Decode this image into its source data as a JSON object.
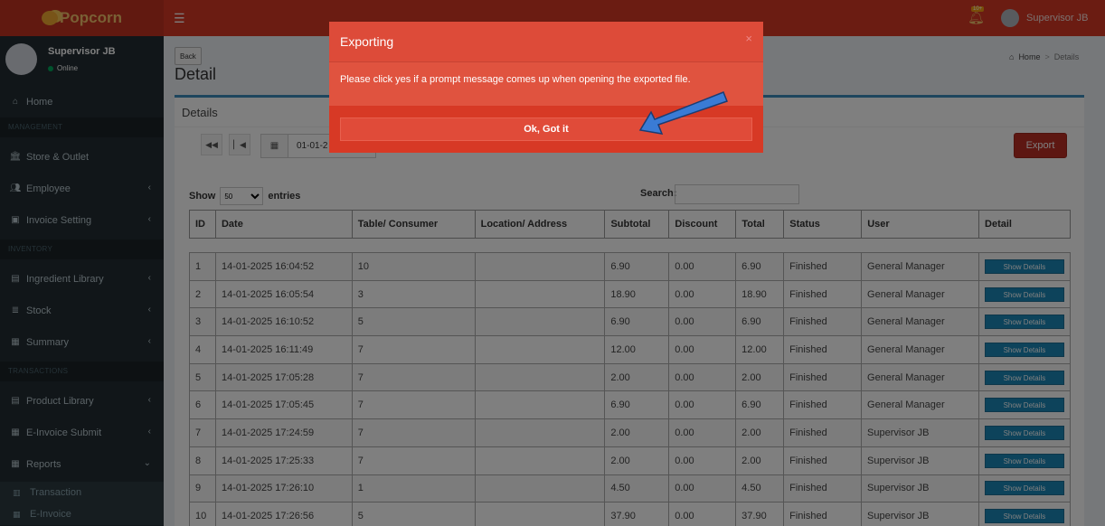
{
  "app": {
    "logo": "Popcorn",
    "notif_badge": "10+",
    "user": "Supervisor JB"
  },
  "sidebar": {
    "user_name": "Supervisor JB",
    "status": "Online",
    "sections": {
      "management": "MANAGEMENT",
      "inventory": "INVENTORY",
      "transactions": "TRANSACTIONS"
    },
    "items": {
      "home": "Home",
      "store": "Store & Outlet",
      "employee": "Employee",
      "invoice": "Invoice Setting",
      "ingredient": "Ingredient Library",
      "stock": "Stock",
      "summary": "Summary",
      "product": "Product Library",
      "einvoice_submit": "E-Invoice Submit",
      "reports": "Reports",
      "transaction": "Transaction",
      "einvoice": "E-Invoice"
    }
  },
  "page": {
    "back": "Back",
    "title": "Detail",
    "breadcrumb_home": "Home",
    "breadcrumb_current": "Details",
    "box_title": "Details",
    "date_value": "01-01-2",
    "export": "Export",
    "show": "Show",
    "entries_value": "50",
    "entries": "entries",
    "search": "Search:"
  },
  "table": {
    "headers": {
      "id": "ID",
      "date": "Date",
      "table": "Table/ Consumer",
      "location": "Location/ Address",
      "subtotal": "Subtotal",
      "discount": "Discount",
      "total": "Total",
      "status": "Status",
      "user": "User",
      "detail": "Detail"
    },
    "detail_label": "Show Details",
    "rows": [
      {
        "id": "1",
        "date": "14-01-2025 16:04:52",
        "table": "10",
        "location": "",
        "subtotal": "6.90",
        "discount": "0.00",
        "total": "6.90",
        "status": "Finished",
        "user": "General Manager"
      },
      {
        "id": "2",
        "date": "14-01-2025 16:05:54",
        "table": "3",
        "location": "",
        "subtotal": "18.90",
        "discount": "0.00",
        "total": "18.90",
        "status": "Finished",
        "user": "General Manager"
      },
      {
        "id": "3",
        "date": "14-01-2025 16:10:52",
        "table": "5",
        "location": "",
        "subtotal": "6.90",
        "discount": "0.00",
        "total": "6.90",
        "status": "Finished",
        "user": "General Manager"
      },
      {
        "id": "4",
        "date": "14-01-2025 16:11:49",
        "table": "7",
        "location": "",
        "subtotal": "12.00",
        "discount": "0.00",
        "total": "12.00",
        "status": "Finished",
        "user": "General Manager"
      },
      {
        "id": "5",
        "date": "14-01-2025 17:05:28",
        "table": "7",
        "location": "",
        "subtotal": "2.00",
        "discount": "0.00",
        "total": "2.00",
        "status": "Finished",
        "user": "General Manager"
      },
      {
        "id": "6",
        "date": "14-01-2025 17:05:45",
        "table": "7",
        "location": "",
        "subtotal": "6.90",
        "discount": "0.00",
        "total": "6.90",
        "status": "Finished",
        "user": "General Manager"
      },
      {
        "id": "7",
        "date": "14-01-2025 17:24:59",
        "table": "7",
        "location": "",
        "subtotal": "2.00",
        "discount": "0.00",
        "total": "2.00",
        "status": "Finished",
        "user": "Supervisor JB"
      },
      {
        "id": "8",
        "date": "14-01-2025 17:25:33",
        "table": "7",
        "location": "",
        "subtotal": "2.00",
        "discount": "0.00",
        "total": "2.00",
        "status": "Finished",
        "user": "Supervisor JB"
      },
      {
        "id": "9",
        "date": "14-01-2025 17:26:10",
        "table": "1",
        "location": "",
        "subtotal": "4.50",
        "discount": "0.00",
        "total": "4.50",
        "status": "Finished",
        "user": "Supervisor JB"
      },
      {
        "id": "10",
        "date": "14-01-2025 17:26:56",
        "table": "5",
        "location": "",
        "subtotal": "37.90",
        "discount": "0.00",
        "total": "37.90",
        "status": "Finished",
        "user": "Supervisor JB"
      }
    ]
  },
  "modal": {
    "title": "Exporting",
    "close": "×",
    "message": "Please click yes if a prompt message comes up when opening the exported file.",
    "ok": "Ok, Got it"
  },
  "colors": {
    "header": "#d73925",
    "sidebar": "#222d32",
    "modal": "#dd4b39",
    "detail_button": "#1a86b6",
    "arrow": "#3a7bd5"
  }
}
